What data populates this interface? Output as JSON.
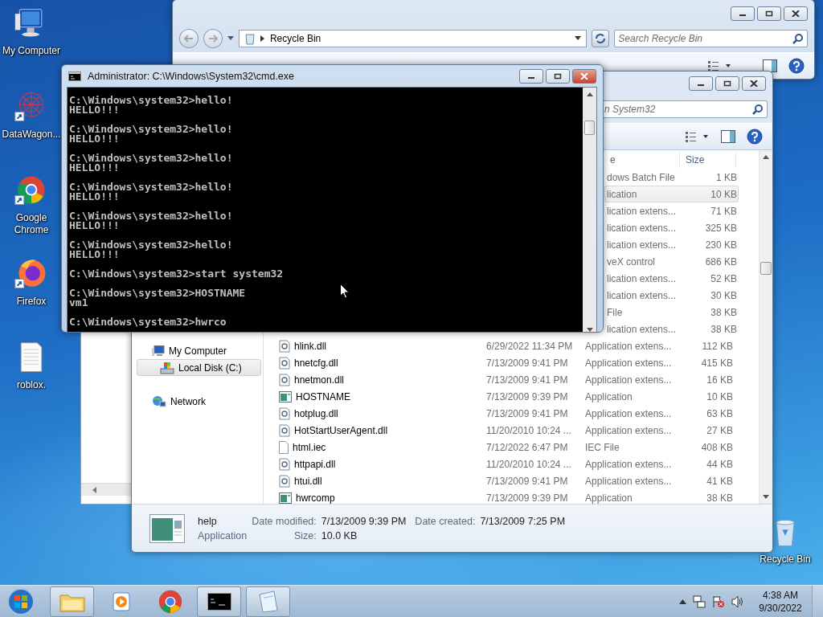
{
  "desktop_icons": [
    {
      "label": "My Computer",
      "kind": "computer",
      "shortcut": false
    },
    {
      "label": "DataWagon...",
      "kind": "network",
      "shortcut": true
    },
    {
      "label": "Google Chrome",
      "kind": "chrome",
      "shortcut": true
    },
    {
      "label": "Firefox",
      "kind": "firefox",
      "shortcut": true
    },
    {
      "label": "roblox.",
      "kind": "document",
      "shortcut": false
    }
  ],
  "recycle_bin_icon": {
    "label": "Recycle Bin"
  },
  "recycle_bin_window": {
    "address": "Recycle Bin",
    "search_placeholder": "Search Recycle Bin"
  },
  "explorer_window": {
    "search_placeholder": "n System32",
    "columns": [
      {
        "label": "e"
      },
      {
        "label": "Size"
      }
    ],
    "nav_groups": [
      {
        "items": [
          {
            "label": "My Computer",
            "kind": "computer",
            "selected": false
          },
          {
            "label": "Local Disk (C:)",
            "kind": "drive",
            "selected": true
          }
        ]
      },
      {
        "items": [
          {
            "label": "Network",
            "kind": "network",
            "selected": false
          }
        ]
      }
    ],
    "rows": [
      {
        "kind": "covered",
        "type": "dows Batch File",
        "size": "1 KB",
        "selected": false
      },
      {
        "kind": "covered",
        "type": "lication",
        "size": "10 KB",
        "selected": true
      },
      {
        "kind": "covered",
        "type": "lication extens...",
        "size": "71 KB",
        "selected": false
      },
      {
        "kind": "covered",
        "type": "lication extens...",
        "size": "325 KB",
        "selected": false
      },
      {
        "kind": "covered",
        "type": "lication extens...",
        "size": "230 KB",
        "selected": false
      },
      {
        "kind": "covered",
        "type": "veX control",
        "size": "686 KB",
        "selected": false
      },
      {
        "kind": "covered",
        "type": "lication extens...",
        "size": "52 KB",
        "selected": false
      },
      {
        "kind": "covered",
        "type": "lication extens...",
        "size": "30 KB",
        "selected": false
      },
      {
        "kind": "covered",
        "type": "File",
        "size": "38 KB",
        "selected": false
      },
      {
        "kind": "covered",
        "type": "lication extens...",
        "size": "38 KB",
        "selected": false
      },
      {
        "kind": "dll",
        "name": "hlink.dll",
        "date": "6/29/2022 11:34 PM",
        "type": "Application extens...",
        "size": "112 KB",
        "selected": false
      },
      {
        "kind": "dll",
        "name": "hnetcfg.dll",
        "date": "7/13/2009 9:41 PM",
        "type": "Application extens...",
        "size": "415 KB",
        "selected": false
      },
      {
        "kind": "dll",
        "name": "hnetmon.dll",
        "date": "7/13/2009 9:41 PM",
        "type": "Application extens...",
        "size": "16 KB",
        "selected": false
      },
      {
        "kind": "app",
        "name": "HOSTNAME",
        "date": "7/13/2009 9:39 PM",
        "type": "Application",
        "size": "10 KB",
        "selected": false
      },
      {
        "kind": "dll",
        "name": "hotplug.dll",
        "date": "7/13/2009 9:41 PM",
        "type": "Application extens...",
        "size": "63 KB",
        "selected": false
      },
      {
        "kind": "dll",
        "name": "HotStartUserAgent.dll",
        "date": "11/20/2010 10:24 ...",
        "type": "Application extens...",
        "size": "27 KB",
        "selected": false
      },
      {
        "kind": "file",
        "name": "html.iec",
        "date": "7/12/2022 6:47 PM",
        "type": "IEC File",
        "size": "408 KB",
        "selected": false
      },
      {
        "kind": "dll",
        "name": "httpapi.dll",
        "date": "11/20/2010 10:24 ...",
        "type": "Application extens...",
        "size": "44 KB",
        "selected": false
      },
      {
        "kind": "dll",
        "name": "htui.dll",
        "date": "7/13/2009 9:41 PM",
        "type": "Application extens...",
        "size": "41 KB",
        "selected": false
      },
      {
        "kind": "app",
        "name": "hwrcomp",
        "date": "7/13/2009 9:39 PM",
        "type": "Application",
        "size": "38 KB",
        "selected": false
      }
    ],
    "details": {
      "name": "help",
      "type": "Application",
      "modified_label": "Date modified:",
      "modified": "7/13/2009 9:39 PM",
      "created_label": "Date created:",
      "created": "7/13/2009 7:25 PM",
      "size_label": "Size:",
      "size": "10.0 KB"
    }
  },
  "cmd_window": {
    "title": "Administrator: C:\\Windows\\System32\\cmd.exe",
    "entries": [
      {
        "command": "C:\\Windows\\system32>hello!",
        "output": "HELLO!!!"
      },
      {
        "command": "C:\\Windows\\system32>hello!",
        "output": "HELLO!!!"
      },
      {
        "command": "C:\\Windows\\system32>hello!",
        "output": "HELLO!!!"
      },
      {
        "command": "C:\\Windows\\system32>hello!",
        "output": "HELLO!!!"
      },
      {
        "command": "C:\\Windows\\system32>hello!",
        "output": "HELLO!!!"
      },
      {
        "command": "C:\\Windows\\system32>hello!",
        "output": "HELLO!!!"
      },
      {
        "command": "C:\\Windows\\system32>start system32"
      },
      {
        "command": "C:\\Windows\\system32>HOSTNAME",
        "output": "vm1"
      },
      {
        "command": "C:\\Windows\\system32>hwrco"
      }
    ]
  },
  "taskbar": {
    "items": [
      {
        "kind": "explorer",
        "running": true
      },
      {
        "kind": "media",
        "running": false
      },
      {
        "kind": "chrome",
        "running": false
      },
      {
        "kind": "cmd",
        "running": true
      },
      {
        "kind": "notepad",
        "running": true
      }
    ],
    "clock": {
      "time": "4:38 AM",
      "date": "9/30/2022"
    }
  }
}
